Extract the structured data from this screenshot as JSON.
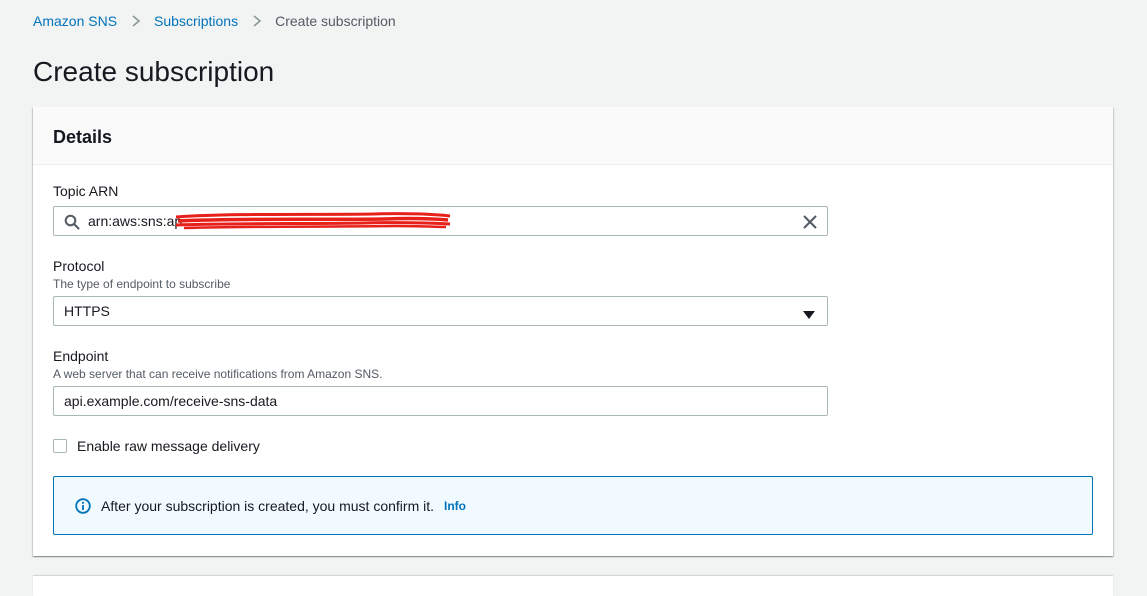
{
  "breadcrumb": {
    "items": [
      {
        "label": "Amazon SNS"
      },
      {
        "label": "Subscriptions"
      },
      {
        "label": "Create subscription"
      }
    ]
  },
  "page": {
    "title": "Create subscription"
  },
  "details": {
    "title": "Details",
    "topic_arn": {
      "label": "Topic ARN",
      "value": "arn:aws:sns:ap"
    },
    "protocol": {
      "label": "Protocol",
      "description": "The type of endpoint to subscribe",
      "selected": "HTTPS"
    },
    "endpoint": {
      "label": "Endpoint",
      "description": "A web server that can receive notifications from Amazon SNS.",
      "value": "api.example.com/receive-sns-data"
    },
    "raw_delivery": {
      "label": "Enable raw message delivery",
      "checked": false
    },
    "alert": {
      "text": "After your subscription is created, you must confirm it.",
      "link": "Info"
    }
  },
  "colors": {
    "link": "#0073bb",
    "background": "#f2f3f3",
    "alert_bg": "#f1faff",
    "redaction": "#e8201a"
  },
  "icons": {
    "search": "search-icon",
    "clear": "close-icon",
    "dropdown": "caret-down-icon",
    "info": "info-icon",
    "separator": "chevron-right-icon"
  }
}
